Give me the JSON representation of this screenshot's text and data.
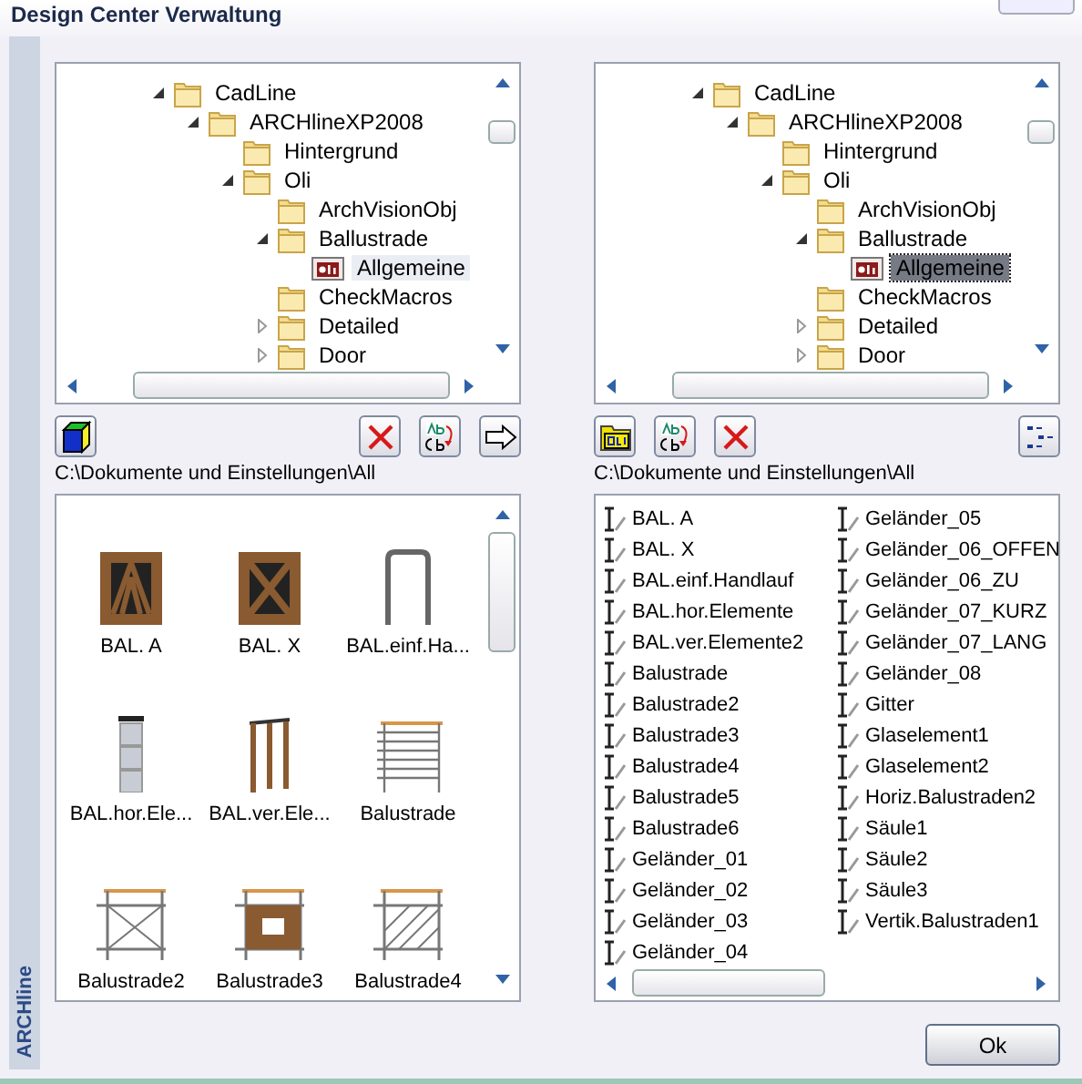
{
  "window": {
    "title": "Design Center Verwaltung"
  },
  "side_tab": {
    "label": "ARCHline"
  },
  "panels": [
    {
      "tree": {
        "focused": false,
        "items": [
          {
            "label": "CadLine",
            "kind": "folder",
            "expanded": true,
            "children": [
              {
                "label": "ARCHlineXP2008",
                "kind": "folder",
                "expanded": true,
                "children": [
                  {
                    "label": "Hintergrund",
                    "kind": "folder"
                  },
                  {
                    "label": "Oli",
                    "kind": "folder",
                    "expanded": true,
                    "children": [
                      {
                        "label": "ArchVisionObj",
                        "kind": "folder"
                      },
                      {
                        "label": "Ballustrade",
                        "kind": "folder",
                        "expanded": true,
                        "children": [
                          {
                            "label": "Allgemeine",
                            "kind": "library",
                            "selected": true
                          }
                        ]
                      },
                      {
                        "label": "CheckMacros",
                        "kind": "folder"
                      },
                      {
                        "label": "Detailed",
                        "kind": "folder",
                        "expanded": false
                      },
                      {
                        "label": "Door",
                        "kind": "folder",
                        "expanded": false
                      }
                    ]
                  }
                ]
              }
            ]
          }
        ]
      },
      "toolbar": {
        "left": [
          {
            "kind": "cube"
          }
        ],
        "right": [
          {
            "kind": "delete"
          },
          {
            "kind": "rename"
          },
          {
            "kind": "arrow"
          }
        ]
      },
      "path": "C:\\Dokumente und Einstellungen\\All",
      "icon_view": [
        {
          "label": "BAL. A",
          "kind": "frame-a"
        },
        {
          "label": "BAL. X",
          "kind": "frame-x"
        },
        {
          "label": "BAL.einf.Ha...",
          "kind": "handrail"
        },
        {
          "label": "BAL.hor.Ele...",
          "kind": "pillar"
        },
        {
          "label": "BAL.ver.Ele...",
          "kind": "posts"
        },
        {
          "label": "Balustrade",
          "kind": "bars"
        },
        {
          "label": "Balustrade2",
          "kind": "cross"
        },
        {
          "label": "Balustrade3",
          "kind": "panel"
        },
        {
          "label": "Balustrade4",
          "kind": "hatch"
        }
      ]
    },
    {
      "tree": {
        "focused": true,
        "items": [
          {
            "label": "CadLine",
            "kind": "folder",
            "expanded": true,
            "children": [
              {
                "label": "ARCHlineXP2008",
                "kind": "folder",
                "expanded": true,
                "children": [
                  {
                    "label": "Hintergrund",
                    "kind": "folder"
                  },
                  {
                    "label": "Oli",
                    "kind": "folder",
                    "expanded": true,
                    "children": [
                      {
                        "label": "ArchVisionObj",
                        "kind": "folder"
                      },
                      {
                        "label": "Ballustrade",
                        "kind": "folder",
                        "expanded": true,
                        "children": [
                          {
                            "label": "Allgemeine",
                            "kind": "library",
                            "selected": true
                          }
                        ]
                      },
                      {
                        "label": "CheckMacros",
                        "kind": "folder"
                      },
                      {
                        "label": "Detailed",
                        "kind": "folder",
                        "expanded": false
                      },
                      {
                        "label": "Door",
                        "kind": "folder",
                        "expanded": false
                      }
                    ]
                  }
                ]
              }
            ]
          }
        ]
      },
      "toolbar": {
        "left": [
          {
            "kind": "oli"
          },
          {
            "kind": "rename"
          },
          {
            "kind": "delete"
          }
        ],
        "right": [
          {
            "kind": "treeview"
          }
        ]
      },
      "path": "C:\\Dokumente und Einstellungen\\All",
      "list_view": [
        {
          "label": "BAL. A"
        },
        {
          "label": "BAL. X"
        },
        {
          "label": "BAL.einf.Handlauf"
        },
        {
          "label": "BAL.hor.Elemente"
        },
        {
          "label": "BAL.ver.Elemente2"
        },
        {
          "label": "Balustrade"
        },
        {
          "label": "Balustrade2"
        },
        {
          "label": "Balustrade3"
        },
        {
          "label": "Balustrade4"
        },
        {
          "label": "Balustrade5"
        },
        {
          "label": "Balustrade6"
        },
        {
          "label": "Geländer_01"
        },
        {
          "label": "Geländer_02"
        },
        {
          "label": "Geländer_03"
        },
        {
          "label": "Geländer_04"
        },
        {
          "label": "Geländer_05"
        },
        {
          "label": "Geländer_06_OFFEN"
        },
        {
          "label": "Geländer_06_ZU"
        },
        {
          "label": "Geländer_07_KURZ"
        },
        {
          "label": "Geländer_07_LANG"
        },
        {
          "label": "Geländer_08"
        },
        {
          "label": "Gitter"
        },
        {
          "label": "Glaselement1"
        },
        {
          "label": "Glaselement2"
        },
        {
          "label": "Horiz.Balustraden2"
        },
        {
          "label": "Säule1"
        },
        {
          "label": "Säule2"
        },
        {
          "label": "Säule3"
        },
        {
          "label": "Vertik.Balustraden1"
        }
      ]
    }
  ],
  "ok_button": "Ok"
}
